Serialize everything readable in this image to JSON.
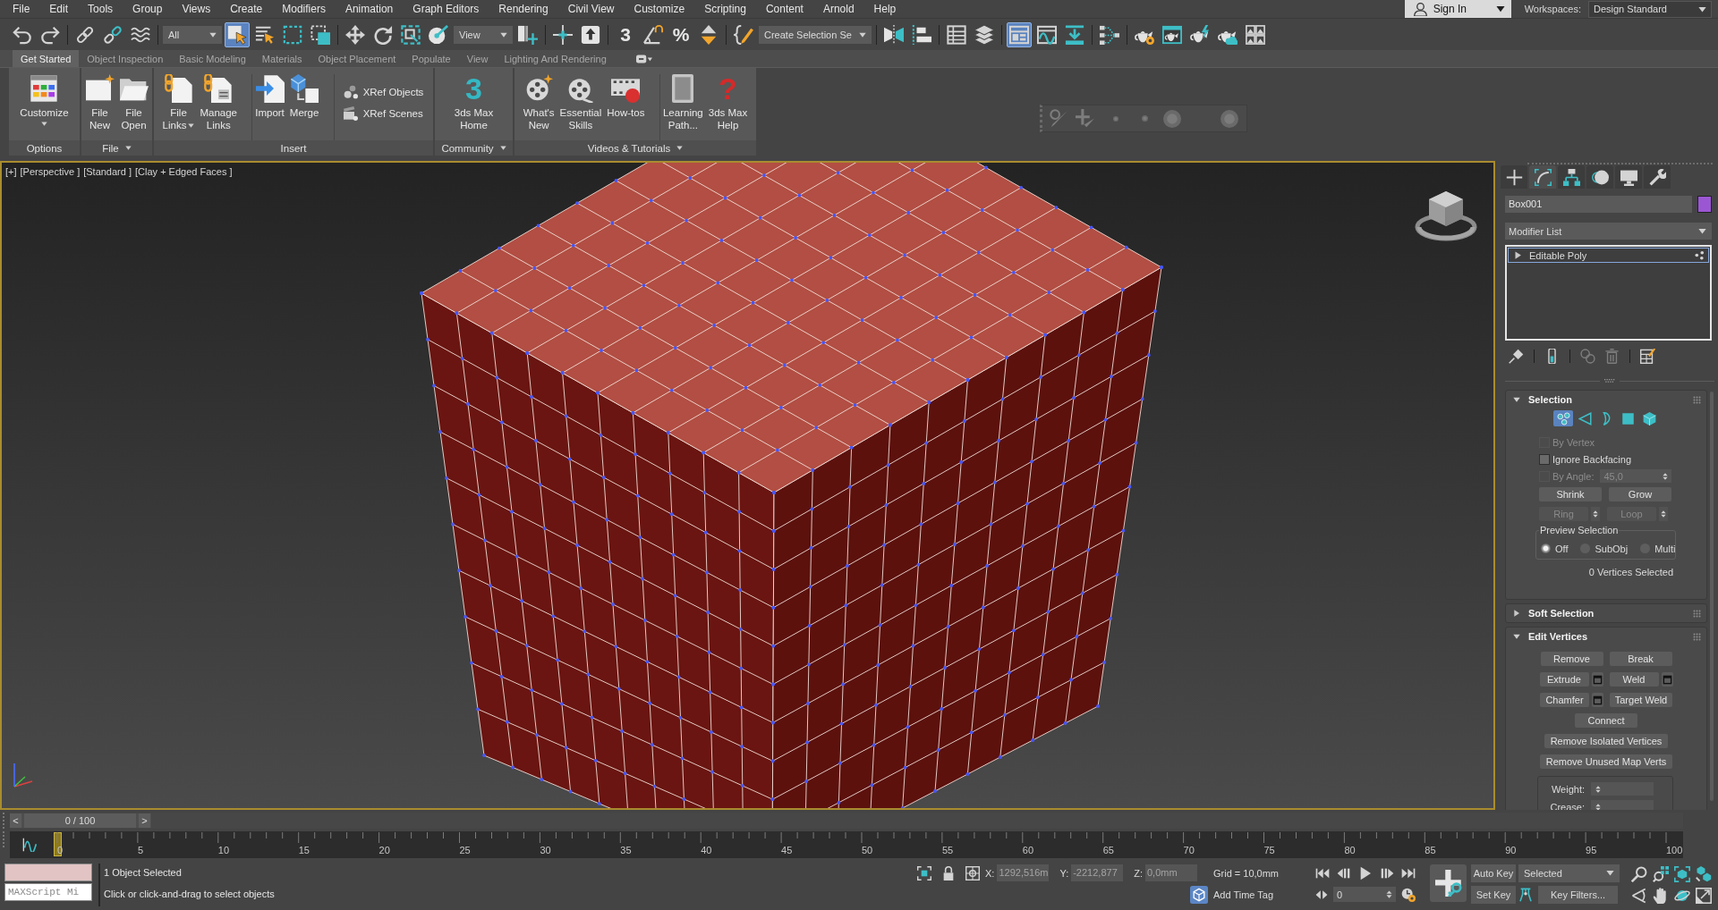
{
  "menu_bar": {
    "items": [
      "File",
      "Edit",
      "Tools",
      "Group",
      "Views",
      "Create",
      "Modifiers",
      "Animation",
      "Graph Editors",
      "Rendering",
      "Civil View",
      "Customize",
      "Scripting",
      "Content",
      "Arnold",
      "Help"
    ],
    "account": "Sign In",
    "workspaces_label": "Workspaces:",
    "workspace": "Design Standard"
  },
  "main_toolbar": {
    "groups": [
      [
        {
          "kind": "undo",
          "selected": false
        },
        {
          "kind": "redo",
          "selected": false
        }
      ],
      [
        {
          "kind": "link",
          "selected": false
        },
        {
          "kind": "unlink",
          "selected": false
        },
        {
          "kind": "bind-space-warp",
          "selected": false
        }
      ],
      [
        {
          "kind": "dropdown",
          "value": "All"
        },
        {
          "kind": "select-object",
          "selected": true
        },
        {
          "kind": "select-by-name",
          "selected": false
        },
        {
          "kind": "rectangular-region",
          "selected": false
        },
        {
          "kind": "window-crossing",
          "selected": false
        }
      ],
      [
        {
          "kind": "move",
          "selected": false
        },
        {
          "kind": "rotate",
          "selected": false
        },
        {
          "kind": "scale",
          "selected": false
        },
        {
          "kind": "place",
          "selected": false
        },
        {
          "kind": "dropdown",
          "value": "View"
        },
        {
          "kind": "use-pivot",
          "selected": false
        }
      ],
      [
        {
          "kind": "manipulate",
          "selected": false
        },
        {
          "kind": "keyboard-override",
          "selected": false
        }
      ],
      [
        {
          "kind": "snaps",
          "glyph": "3",
          "selected": false
        },
        {
          "kind": "angle-snap",
          "selected": false
        },
        {
          "kind": "percent-snap",
          "glyph": "%",
          "selected": false
        },
        {
          "kind": "spinner-snap",
          "selected": false
        }
      ],
      [
        {
          "kind": "edit-named-selection",
          "selected": false
        },
        {
          "kind": "dropdown",
          "value": "Create Selection Se"
        }
      ],
      [
        {
          "kind": "mirror",
          "selected": false
        },
        {
          "kind": "align",
          "selected": false
        }
      ],
      [
        {
          "kind": "scene-explorer",
          "selected": false
        },
        {
          "kind": "layer-explorer",
          "selected": false
        }
      ],
      [
        {
          "kind": "toggle-ribbon",
          "selected": true
        },
        {
          "kind": "curve-editor",
          "selected": false
        },
        {
          "kind": "dope-sheet",
          "selected": false
        }
      ],
      [
        {
          "kind": "schematic-view",
          "selected": false
        }
      ],
      [
        {
          "kind": "render-setup",
          "selected": false
        },
        {
          "kind": "rendered-frame-window",
          "selected": false
        },
        {
          "kind": "render",
          "selected": false
        },
        {
          "kind": "render-cloud",
          "selected": false
        },
        {
          "kind": "gallery",
          "selected": false
        }
      ]
    ]
  },
  "ribbon": {
    "tabs": [
      {
        "label": "Get Started",
        "selected": true
      },
      {
        "label": "Object Inspection",
        "selected": false
      },
      {
        "label": "Basic Modeling",
        "selected": false
      },
      {
        "label": "Materials",
        "selected": false
      },
      {
        "label": "Object Placement",
        "selected": false
      },
      {
        "label": "Populate",
        "selected": false
      },
      {
        "label": "View",
        "selected": false
      },
      {
        "label": "Lighting And Rendering",
        "selected": false
      }
    ],
    "groups": [
      {
        "title": "Options",
        "menu": false,
        "sections": [
          {
            "kind": "large",
            "items": [
              {
                "kind": "customize",
                "lines": [
                  "Customize"
                ],
                "menu": true
              }
            ]
          }
        ]
      },
      {
        "title": "File",
        "menu": true,
        "sections": [
          {
            "kind": "large",
            "items": [
              {
                "kind": "file-new",
                "lines": [
                  "File",
                  "New"
                ],
                "menu": false
              },
              {
                "kind": "file-open",
                "lines": [
                  "File",
                  "Open"
                ],
                "menu": false
              }
            ]
          }
        ]
      },
      {
        "title": "Insert",
        "menu": false,
        "sections": [
          {
            "kind": "large",
            "items": [
              {
                "kind": "file-links",
                "lines": [
                  "File",
                  "Links"
                ],
                "menu": true
              },
              {
                "kind": "manage-links",
                "lines": [
                  "Manage",
                  "Links"
                ],
                "menu": false
              }
            ]
          },
          {
            "kind": "large",
            "items": [
              {
                "kind": "import",
                "lines": [
                  "Import"
                ],
                "menu": false
              },
              {
                "kind": "merge",
                "lines": [
                  "Merge"
                ],
                "menu": false
              }
            ]
          },
          {
            "kind": "small",
            "items": [
              {
                "kind": "xref-objects",
                "label": "XRef Objects"
              },
              {
                "kind": "xref-scenes",
                "label": "XRef Scenes"
              }
            ]
          }
        ]
      },
      {
        "title": "Community",
        "menu": true,
        "sections": [
          {
            "kind": "large",
            "items": [
              {
                "kind": "max-home",
                "glyph": "3",
                "lines": [
                  "3ds Max",
                  "Home"
                ],
                "menu": false
              }
            ]
          }
        ]
      },
      {
        "title": "Videos & Tutorials",
        "menu": true,
        "sections": [
          {
            "kind": "large",
            "items": [
              {
                "kind": "whats-new",
                "lines": [
                  "What's",
                  "New"
                ],
                "menu": false
              },
              {
                "kind": "essential-skills",
                "lines": [
                  "Essential",
                  "Skills"
                ],
                "menu": false
              },
              {
                "kind": "how-tos",
                "lines": [
                  "How-tos"
                ],
                "menu": false
              }
            ]
          },
          {
            "kind": "large",
            "items": [
              {
                "kind": "learning-path",
                "lines": [
                  "Learning",
                  "Path..."
                ],
                "menu": false
              },
              {
                "kind": "max-help",
                "glyph": "?",
                "lines": [
                  "3ds Max",
                  "Help"
                ],
                "menu": false
              }
            ]
          }
        ]
      }
    ]
  },
  "viewport": {
    "active": true,
    "labels": [
      "[+]",
      "[Perspective ]",
      "[Standard ]",
      "[Clay + Edged Faces ]"
    ]
  },
  "command_panel": {
    "tabs": [
      {
        "kind": "create",
        "selected": false
      },
      {
        "kind": "modify",
        "selected": true
      },
      {
        "kind": "hierarchy",
        "selected": false
      },
      {
        "kind": "motion",
        "selected": false
      },
      {
        "kind": "display",
        "selected": false
      },
      {
        "kind": "utilities",
        "selected": false
      }
    ],
    "object": {
      "name": "Box001",
      "color": "#9b57d3"
    },
    "modifier_list": "Modifier List",
    "stack": [
      {
        "label": "Editable Poly",
        "expanded": false,
        "selected": true
      }
    ],
    "stack_tools": [
      [
        {
          "kind": "pin",
          "disabled": false
        }
      ],
      [
        {
          "kind": "end-result",
          "disabled": false
        }
      ],
      [
        {
          "kind": "make-unique",
          "disabled": true
        },
        {
          "kind": "remove",
          "disabled": true
        }
      ],
      [
        {
          "kind": "configure",
          "disabled": false
        }
      ]
    ],
    "rollouts": [
      {
        "kind": "selection",
        "title": "Selection",
        "expanded": true,
        "levels": [
          {
            "kind": "vertex",
            "selected": true
          },
          {
            "kind": "edge",
            "selected": false
          },
          {
            "kind": "border",
            "selected": false
          },
          {
            "kind": "polygon",
            "selected": false
          },
          {
            "kind": "element",
            "selected": false
          }
        ],
        "options": [
          {
            "kind": "check",
            "label": "By Vertex",
            "checked": false,
            "disabled": true
          },
          {
            "kind": "check",
            "label": "Ignore Backfacing",
            "checked": false,
            "disabled": false
          },
          {
            "kind": "check_spinner",
            "label": "By Angle:",
            "checked": false,
            "disabled": true,
            "value": "45,0"
          }
        ],
        "grow_buttons": [
          {
            "label": "Shrink",
            "disabled": false
          },
          {
            "label": "Grow",
            "disabled": false
          }
        ],
        "loop_buttons": [
          {
            "label": "Ring",
            "disabled": true
          },
          {
            "label": "Loop",
            "disabled": true
          }
        ],
        "preview": {
          "title": "Preview Selection",
          "options": [
            {
              "label": "Off",
              "selected": true
            },
            {
              "label": "SubObj",
              "selected": false
            },
            {
              "label": "Multi",
              "selected": false
            }
          ]
        },
        "status": "0 Vertices Selected"
      },
      {
        "title": "Soft Selection",
        "expanded": false
      },
      {
        "kind": "edit_vertices",
        "title": "Edit Vertices",
        "expanded": true,
        "rows": [
          [
            {
              "label": "Remove",
              "settings": false
            },
            {
              "label": "Break",
              "settings": false
            }
          ],
          [
            {
              "label": "Extrude",
              "settings": true
            },
            {
              "label": "Weld",
              "settings": true
            }
          ],
          [
            {
              "label": "Chamfer",
              "settings": true
            },
            {
              "label": "Target Weld",
              "settings": false
            }
          ],
          [
            {
              "label": "Connect",
              "settings": false
            }
          ],
          [
            {
              "label": "Remove Isolated Vertices",
              "settings": false
            }
          ],
          [
            {
              "label": "Remove Unused Map Verts",
              "settings": false
            }
          ]
        ],
        "fields": [
          {
            "label": "Weight:"
          },
          {
            "label": "Crease:"
          }
        ]
      }
    ]
  },
  "time_slider": {
    "prev": "<",
    "label": "0 / 100",
    "next": ">",
    "level": 0
  },
  "track_bar": {
    "labels": [
      "0",
      "5",
      "10",
      "15",
      "20",
      "25",
      "30",
      "35",
      "40",
      "45",
      "50",
      "55",
      "60",
      "65",
      "70",
      "75",
      "80",
      "85",
      "90",
      "95",
      "100"
    ]
  },
  "status_bar": {
    "maxscript": {
      "placeholder": "MAXScript Mi"
    },
    "prompt": {
      "status": "1 Object Selected",
      "hint": "Click or click-and-drag to select objects"
    },
    "coordinates": [
      {
        "axis": "X:",
        "value": "1292,516m"
      },
      {
        "axis": "Y:",
        "value": "-2212,877"
      },
      {
        "axis": "Z:",
        "value": "0,0mm"
      }
    ],
    "grid": "Grid = 10,0mm",
    "time_tag": "Add Time Tag",
    "frame": "0",
    "keys": {
      "auto_key": "Auto Key",
      "key_set": "Selected",
      "set_key": "Set Key",
      "key_filters": "Key Filters..."
    }
  }
}
